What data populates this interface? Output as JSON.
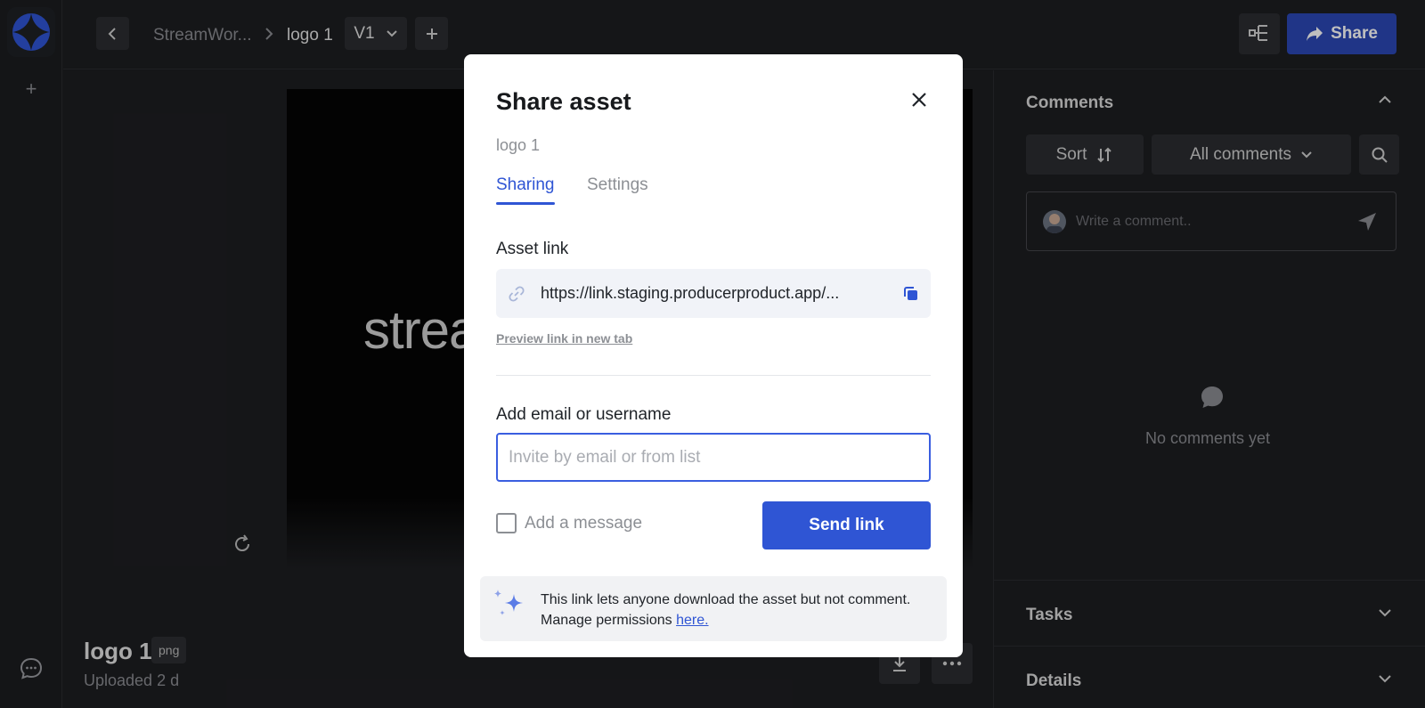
{
  "topbar": {
    "breadcrumb_project": "StreamWor...",
    "breadcrumb_asset": "logo 1",
    "version": "V1",
    "share_label": "Share"
  },
  "preview": {
    "logo_text": "strea"
  },
  "asset": {
    "name": "logo 1",
    "extension": "png",
    "uploaded": "Uploaded 2 d"
  },
  "right_panel": {
    "comments_title": "Comments",
    "sort_label": "Sort",
    "filter_label": "All comments",
    "comment_placeholder": "Write a comment..",
    "empty_state": "No comments yet",
    "tasks_title": "Tasks",
    "details_title": "Details"
  },
  "modal": {
    "title": "Share asset",
    "subtitle": "logo 1",
    "tabs": [
      {
        "label": "Sharing",
        "active": true
      },
      {
        "label": "Settings",
        "active": false
      }
    ],
    "asset_link_label": "Asset link",
    "asset_link_url": "https://link.staging.producerproduct.app/...",
    "preview_link": "Preview link in new tab",
    "add_label": "Add email or username",
    "email_placeholder": "Invite by email or from list",
    "add_message_label": "Add a message",
    "send_label": "Send link",
    "info_text": "This link lets anyone download the asset but not comment. Manage permissions",
    "info_link": "here."
  },
  "colors": {
    "accent": "#2f55d4",
    "background": "#1d1e21"
  }
}
